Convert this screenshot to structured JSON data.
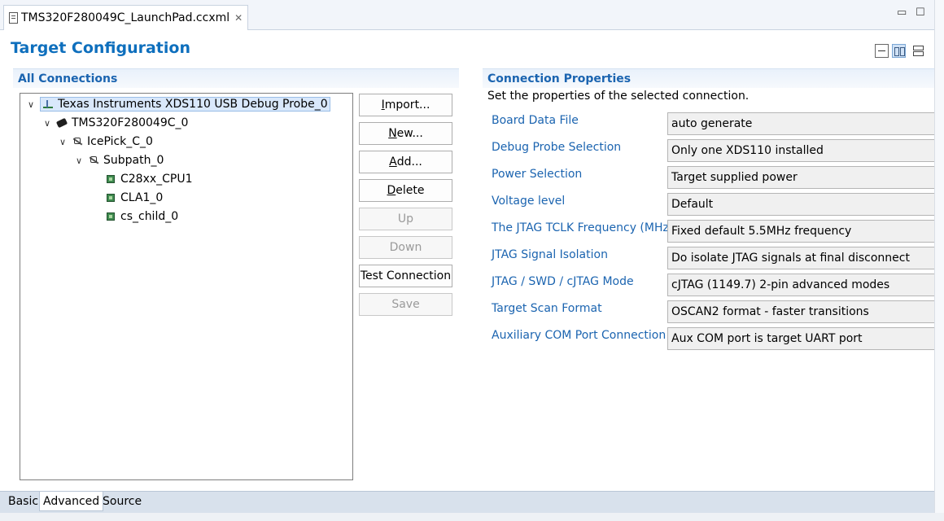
{
  "editor_tab": {
    "title": "TMS320F280049C_LaunchPad.ccxml"
  },
  "window_controls": {
    "minimize": "▭",
    "maximize": "☐"
  },
  "page_title": "Target Configuration",
  "connections": {
    "header": "All Connections",
    "tree": [
      {
        "label": "Texas Instruments XDS110 USB Debug Probe_0",
        "icon": "probe-icon",
        "expanded": true,
        "selected": true
      },
      {
        "label": "TMS320F280049C_0",
        "icon": "device-icon",
        "expanded": true
      },
      {
        "label": "IcePick_C_0",
        "icon": "router-icon",
        "expanded": true
      },
      {
        "label": "Subpath_0",
        "icon": "subpath-icon",
        "expanded": true
      },
      {
        "label": "C28xx_CPU1",
        "icon": "cpu-chip-icon"
      },
      {
        "label": "CLA1_0",
        "icon": "cpu-chip-icon"
      },
      {
        "label": "cs_child_0",
        "icon": "cpu-chip-icon"
      }
    ],
    "buttons": {
      "import": {
        "mnemonic": "I",
        "rest": "mport..."
      },
      "new": {
        "mnemonic": "N",
        "rest": "ew..."
      },
      "add": {
        "mnemonic": "A",
        "rest": "dd..."
      },
      "delete": {
        "mnemonic": "D",
        "rest": "elete"
      },
      "up": "Up",
      "down": "Down",
      "test_connection": "Test Connection",
      "save": "Save"
    }
  },
  "properties": {
    "header": "Connection Properties",
    "description": "Set the properties of the selected connection.",
    "rows": [
      {
        "label": "Board Data File",
        "value": "auto generate"
      },
      {
        "label": "Debug Probe Selection",
        "value": "Only one XDS110 installed"
      },
      {
        "label": "Power Selection",
        "value": "Target supplied power"
      },
      {
        "label": "Voltage level",
        "value": "Default"
      },
      {
        "label": "The JTAG TCLK Frequency (MHz)",
        "value": "Fixed default 5.5MHz frequency"
      },
      {
        "label": "JTAG Signal Isolation",
        "value": "Do isolate JTAG signals at final disconnect"
      },
      {
        "label": "JTAG / SWD / cJTAG Mode",
        "value": "cJTAG (1149.7) 2-pin advanced modes"
      },
      {
        "label": "Target Scan Format",
        "value": "OSCAN2 format - faster transitions"
      },
      {
        "label": "Auxiliary COM Port Connection",
        "value": "Aux COM port is target UART port"
      }
    ]
  },
  "bottom_tabs": [
    {
      "label": "Basic",
      "active": false
    },
    {
      "label": "Advanced",
      "active": true
    },
    {
      "label": "Source",
      "active": false
    }
  ]
}
